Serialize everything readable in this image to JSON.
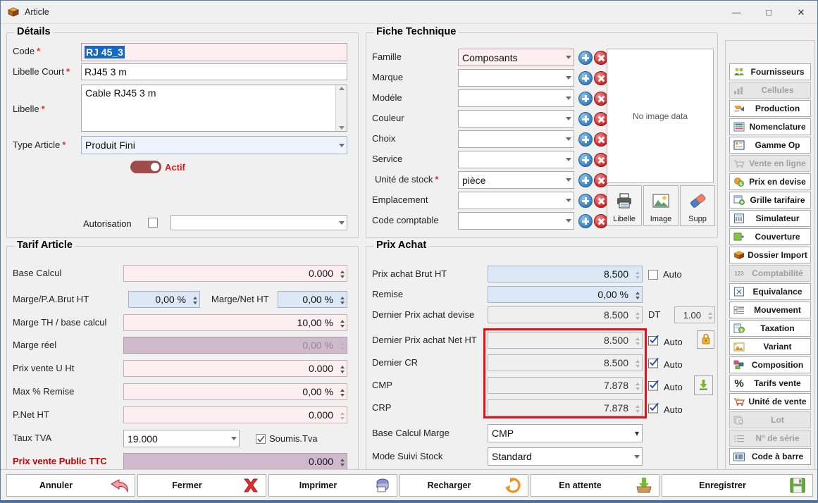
{
  "window": {
    "title": "Article",
    "icon": "package-icon",
    "controls": {
      "minimize": "—",
      "maximize": "□",
      "close": "✕"
    }
  },
  "details": {
    "legend": "Détails",
    "code": {
      "label": "Code",
      "required": "*",
      "value": "RJ 45_3"
    },
    "libelle_court": {
      "label": "Libelle Court",
      "required": "*",
      "value": "RJ45 3 m"
    },
    "libelle": {
      "label": "Libelle",
      "required": "*",
      "value": "Cable RJ45 3 m"
    },
    "type_article": {
      "label": "Type Article",
      "required": "*",
      "value": "Produit Fini"
    },
    "actif": {
      "label": "Actif",
      "state": "on"
    },
    "autorisation": {
      "label": "Autorisation",
      "checked": false,
      "value": ""
    }
  },
  "tarif": {
    "legend": "Tarif Article",
    "rows": [
      {
        "label": "Base Calcul",
        "value": "0.000",
        "style": "pink"
      },
      {
        "label": "Marge/P.A.Brut HT",
        "value": "0,00 %",
        "style": "blue",
        "label2": "Marge/Net HT",
        "value2": "0,00 %",
        "style2": "blue"
      },
      {
        "label": "Marge TH / base calcul",
        "value": "10,00 %",
        "style": "pink"
      },
      {
        "label": "Marge réel",
        "value": "0,00 %",
        "style": "mauve"
      },
      {
        "label": "Prix vente U Ht",
        "value": "0.000",
        "style": "pink"
      },
      {
        "label": "Max % Remise",
        "value": "0,00 %",
        "style": "pink"
      },
      {
        "label": "P.Net HT",
        "value": "0.000",
        "style": "pink"
      }
    ],
    "taux_tva": {
      "label": "Taux TVA",
      "value": "19.000"
    },
    "soumis_tva": {
      "label": "Soumis.Tva",
      "checked": true
    },
    "prix_public": {
      "label": "Prix vente Public TTC",
      "value": "0.000",
      "style": "mauve"
    }
  },
  "fiche": {
    "legend": "Fiche Technique",
    "rows": [
      {
        "label": "Famille",
        "required": "*",
        "value": "Composants",
        "style": "pink"
      },
      {
        "label": "Marque",
        "value": "",
        "style": "white"
      },
      {
        "label": "Modéle",
        "value": "",
        "style": "white"
      },
      {
        "label": "Couleur",
        "value": "",
        "style": "white"
      },
      {
        "label": "Choix",
        "value": "",
        "style": "white"
      },
      {
        "label": "Service",
        "value": "",
        "style": "white"
      },
      {
        "label": "Unité de stock",
        "required": "*",
        "value": "pièce",
        "style": "white"
      },
      {
        "label": "Emplacement",
        "value": "",
        "style": "white"
      },
      {
        "label": "Code comptable",
        "value": "",
        "style": "white"
      }
    ],
    "image_placeholder": "No image data",
    "image_buttons": [
      {
        "label": "Libelle",
        "icon": "printer-icon"
      },
      {
        "label": "Image",
        "icon": "picture-icon"
      },
      {
        "label": "Supp",
        "icon": "eraser-icon"
      }
    ]
  },
  "prix_achat": {
    "legend": "Prix Achat",
    "rows": [
      {
        "label": "Prix achat Brut HT",
        "value": "8.500",
        "style": "blue",
        "auto_label": "Auto",
        "auto_checked": false
      },
      {
        "label": "Remise",
        "value": "0,00 %",
        "style": "blue"
      },
      {
        "label": "Dernier Prix achat devise",
        "value": "8.500",
        "style": "grey",
        "devise_label": "DT",
        "devise_value": "1.00"
      },
      {
        "label": "Dernier Prix achat Net HT",
        "value": "8.500",
        "style": "grey",
        "auto_label": "Auto",
        "auto_checked": true,
        "side_icon": "lock-icon"
      },
      {
        "label": "Dernier CR",
        "value": "8.500",
        "style": "grey",
        "auto_label": "Auto",
        "auto_checked": true
      },
      {
        "label": "CMP",
        "value": "7.878",
        "style": "grey",
        "auto_label": "Auto",
        "auto_checked": true,
        "side_icon": "download-icon"
      },
      {
        "label": "CRP",
        "value": "7.878",
        "style": "grey",
        "auto_label": "Auto",
        "auto_checked": true
      }
    ],
    "base_calcul_marge": {
      "label": "Base Calcul Marge",
      "value": "CMP"
    },
    "mode_suivi_stock": {
      "label": "Mode Suivi Stock",
      "value": "Standard"
    },
    "highlight_color": "#e81010"
  },
  "sidebar": {
    "items": [
      {
        "label": "Fournisseurs",
        "icon": "suppliers-icon",
        "disabled": false
      },
      {
        "label": "Cellules",
        "icon": "bars-icon",
        "disabled": true
      },
      {
        "label": "Production",
        "icon": "production-icon",
        "disabled": false
      },
      {
        "label": "Nomenclature",
        "icon": "nomenclature-icon",
        "disabled": false
      },
      {
        "label": "Gamme Op",
        "icon": "gamme-icon",
        "disabled": false
      },
      {
        "label": "Vente en ligne",
        "icon": "cart-icon",
        "disabled": true
      },
      {
        "label": "Prix en devise",
        "icon": "currency-icon",
        "disabled": false
      },
      {
        "label": "Grille tarifaire",
        "icon": "grid-add-icon",
        "disabled": false
      },
      {
        "label": "Simulateur",
        "icon": "calculator-icon",
        "disabled": false
      },
      {
        "label": "Couverture",
        "icon": "coverage-icon",
        "disabled": false
      },
      {
        "label": "Dossier Import",
        "icon": "box-icon",
        "disabled": false
      },
      {
        "label": "Comptabilité",
        "icon": "123-icon",
        "disabled": true
      },
      {
        "label": "Equivalance",
        "icon": "equivalence-icon",
        "disabled": false
      },
      {
        "label": "Mouvement",
        "icon": "list-icon",
        "disabled": false
      },
      {
        "label": "Taxation",
        "icon": "tax-icon",
        "disabled": false
      },
      {
        "label": "Variant",
        "icon": "variant-icon",
        "disabled": false
      },
      {
        "label": "Composition",
        "icon": "composition-icon",
        "disabled": false
      },
      {
        "label": "Tarifs vente",
        "icon": "percent-icon",
        "disabled": false
      },
      {
        "label": "Unité de vente",
        "icon": "sale-cart-icon",
        "disabled": false
      },
      {
        "label": "Lot",
        "icon": "lot-icon",
        "disabled": true
      },
      {
        "label": "N° de série",
        "icon": "serial-icon",
        "disabled": true
      },
      {
        "label": "Code à barre",
        "icon": "barcode-icon",
        "disabled": false
      }
    ]
  },
  "bottombar": {
    "buttons": [
      {
        "label": "Annuler",
        "icon": "undo-arrow-icon"
      },
      {
        "label": "Fermer",
        "icon": "red-x-icon"
      },
      {
        "label": "Imprimer",
        "icon": "printer-icon"
      },
      {
        "label": "Recharger",
        "icon": "refresh-icon"
      },
      {
        "label": "En attente",
        "icon": "inbox-down-icon"
      },
      {
        "label": "Enregistrer",
        "icon": "save-icon"
      }
    ]
  }
}
